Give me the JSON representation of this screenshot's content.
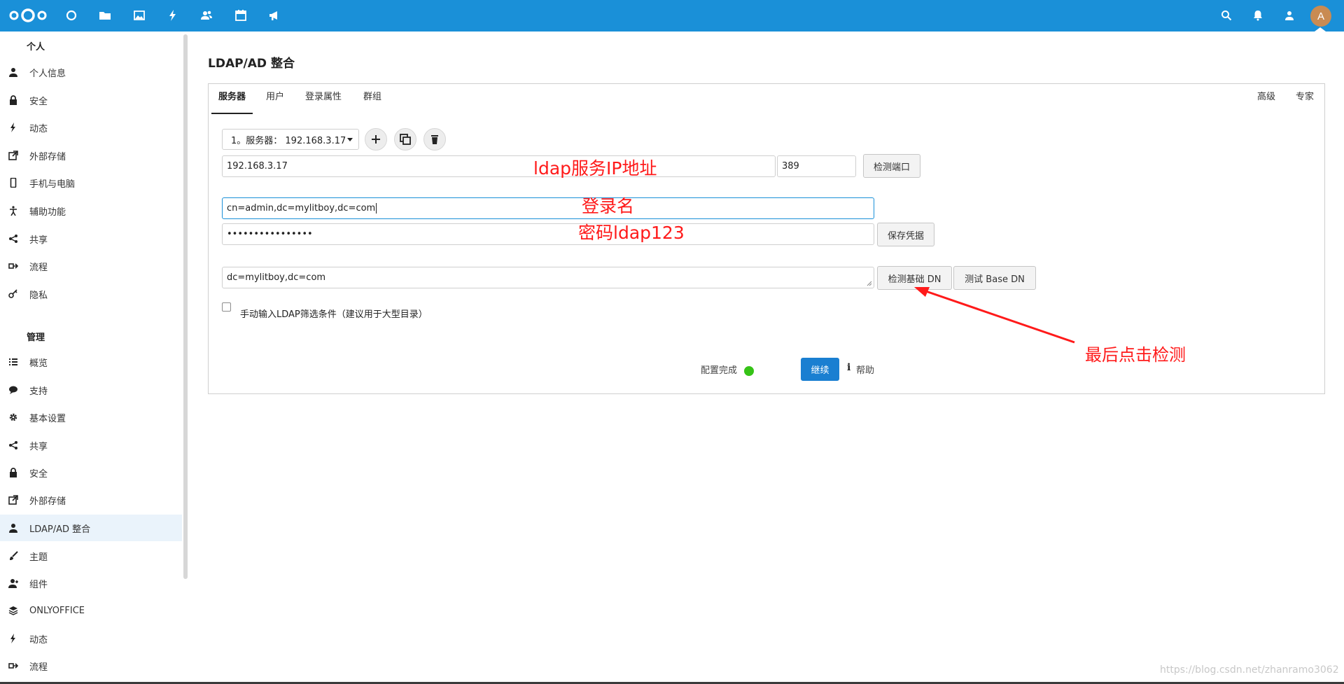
{
  "header": {
    "app_icons": [
      "dashboard-icon",
      "files-icon",
      "photos-icon",
      "activity-icon",
      "contacts-icon",
      "calendar-icon",
      "announcements-icon"
    ],
    "right_icons": [
      "search-icon",
      "notifications-icon",
      "contacts-menu-icon"
    ],
    "avatar_letter": "A",
    "colors": {
      "brand": "#1a90d8",
      "avatar": "#c98b52"
    }
  },
  "sidebar": {
    "personal_title": "个人",
    "personal_items": [
      {
        "label": "个人信息",
        "icon": "user-icon"
      },
      {
        "label": "安全",
        "icon": "lock-icon"
      },
      {
        "label": "动态",
        "icon": "activity-icon"
      },
      {
        "label": "外部存储",
        "icon": "external-link-icon"
      },
      {
        "label": "手机与电脑",
        "icon": "phone-icon"
      },
      {
        "label": "辅助功能",
        "icon": "accessibility-icon"
      },
      {
        "label": "共享",
        "icon": "share-icon"
      },
      {
        "label": "流程",
        "icon": "flow-icon"
      },
      {
        "label": "隐私",
        "icon": "key-icon"
      }
    ],
    "admin_title": "管理",
    "admin_items": [
      {
        "label": "概览",
        "icon": "list-icon"
      },
      {
        "label": "支持",
        "icon": "comment-icon"
      },
      {
        "label": "基本设置",
        "icon": "gear-icon"
      },
      {
        "label": "共享",
        "icon": "share-icon"
      },
      {
        "label": "安全",
        "icon": "lock-icon"
      },
      {
        "label": "外部存储",
        "icon": "external-link-icon"
      },
      {
        "label": "LDAP/AD 整合",
        "icon": "user-icon",
        "active": true
      },
      {
        "label": "主题",
        "icon": "brush-icon"
      },
      {
        "label": "组件",
        "icon": "user-plus-icon"
      },
      {
        "label": "ONLYOFFICE",
        "icon": "layers-icon"
      },
      {
        "label": "动态",
        "icon": "activity-icon"
      },
      {
        "label": "流程",
        "icon": "flow-icon"
      }
    ]
  },
  "main": {
    "title": "LDAP/AD 整合",
    "tabs": [
      "服务器",
      "用户",
      "登录属性",
      "群组"
    ],
    "right_tabs": [
      "高级",
      "专家"
    ],
    "server_select": "1。服务器：  192.168.3.17",
    "host": "192.168.3.17",
    "port": "389",
    "detect_port_label": "检测端口",
    "user_dn": "cn=admin,dc=mylitboy,dc=com",
    "password_mask": "••••••••••••••••",
    "save_credentials_label": "保存凭据",
    "base_dn": "dc=mylitboy,dc=com",
    "detect_base_dn_label": "检测基础 DN",
    "test_base_dn_label": "测试 Base DN",
    "manual_filter_label": "手动输入LDAP筛选条件（建议用于大型目录）",
    "config_status_label": "配置完成",
    "continue_label": "继续",
    "help_label": "帮助"
  },
  "annotations": {
    "ip": "ldap服务IP地址",
    "login": "登录名",
    "password": "密码ldap123",
    "final": "最后点击检测",
    "color": "#ff1a1a"
  },
  "watermark": "https://blog.csdn.net/zhanramo3062"
}
